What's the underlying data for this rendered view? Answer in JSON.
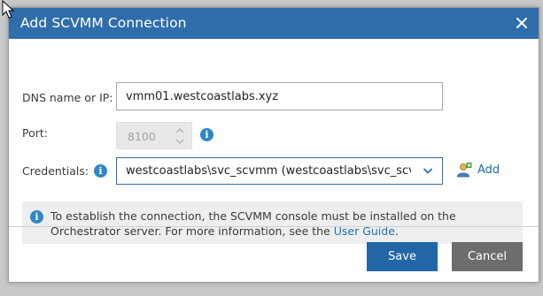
{
  "dialog": {
    "title": "Add SCVMM Connection",
    "close_icon": "close-icon"
  },
  "form": {
    "dns_label": "DNS name or IP:",
    "dns_value": "vmm01.westcoastlabs.xyz",
    "port_label": "Port:",
    "port_value": "8100",
    "credentials_label": "Credentials:",
    "credentials_value": "westcoastlabs\\svc_scvmm (westcoastlabs\\svc_scvmm)",
    "add_label": "Add"
  },
  "info": {
    "text_before": "To establish the connection, the SCVMM console must be installed on the Orchestrator server. For more information, see the ",
    "link": "User Guide",
    "text_after": "."
  },
  "buttons": {
    "save": "Save",
    "cancel": "Cancel"
  },
  "colors": {
    "titlebar": "#2f6eab",
    "save": "#2266a8",
    "cancel": "#6d6d6d",
    "link": "#1f6fb2",
    "info_icon": "#2e86c9"
  }
}
